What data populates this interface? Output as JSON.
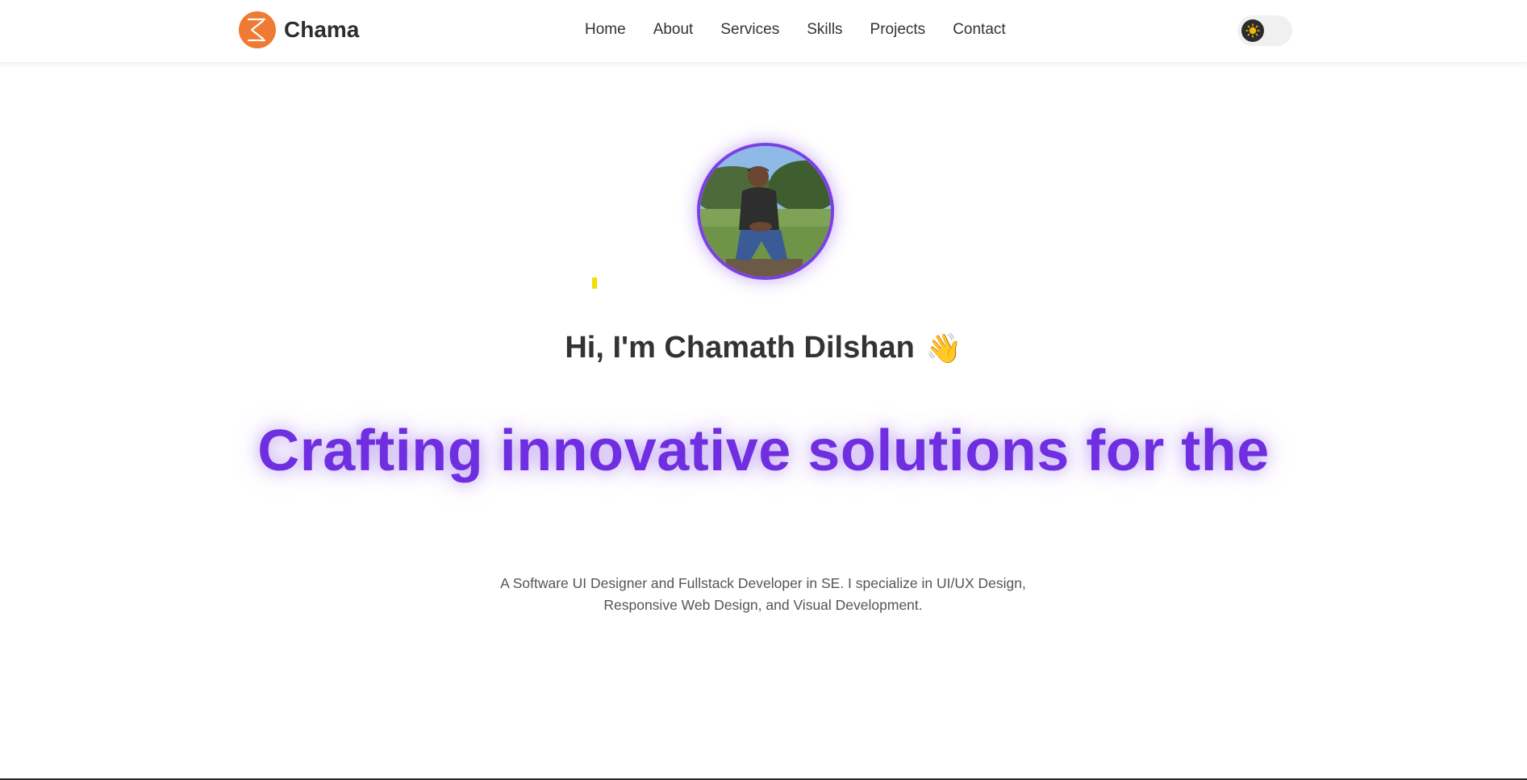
{
  "nav": {
    "brand": "Chama",
    "links": [
      "Home",
      "About",
      "Services",
      "Skills",
      "Projects",
      "Contact"
    ]
  },
  "theme_toggle": {
    "icon": "sun-icon",
    "state": "light"
  },
  "hero": {
    "greeting": "Hi, I'm Chamath Dilshan",
    "wave_emoji": "👋",
    "headline": "Crafting innovative solutions for the",
    "description": "A Software UI Designer and Fullstack Developer in SE. I specialize in UI/UX Design, Responsive Web Design, and Visual Development."
  },
  "colors": {
    "accent": "#6f2ee0",
    "logo": "#ee7a33",
    "avatar_ring": "#7b3fe4"
  }
}
